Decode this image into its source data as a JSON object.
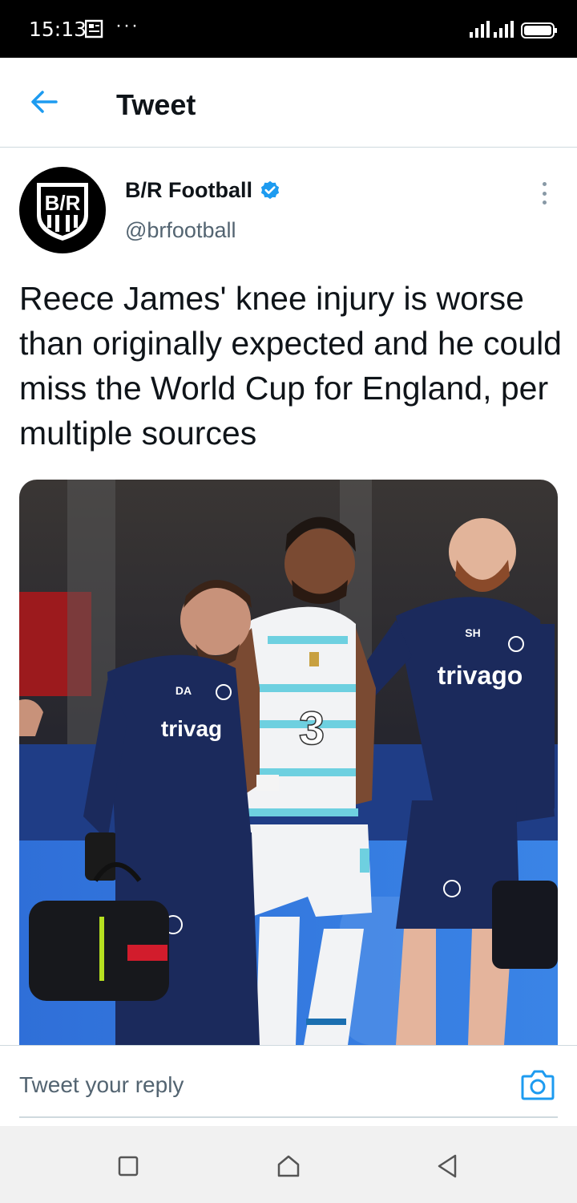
{
  "status_bar": {
    "time": "15:13",
    "notification_icon": "news-icon",
    "overflow_dots": "···"
  },
  "header": {
    "title": "Tweet",
    "back_icon": "arrow-left-icon"
  },
  "tweet": {
    "author_name": "B/R Football",
    "author_handle": "@brfootball",
    "avatar_text": "B/R",
    "verified": true,
    "text": "Reece James' knee injury is worse than originally expected and he could miss the World Cup for England, per multiple sources",
    "media": {
      "kit_sponsor": "trivago",
      "sponsor_partial": "trivag",
      "shirt_number": "3",
      "staff_initials_left": "DA",
      "staff_initials_right": "SH"
    }
  },
  "reply": {
    "placeholder": "Tweet your reply",
    "camera_icon": "camera-icon"
  },
  "nav_bar": {
    "recent_icon": "square-icon",
    "home_icon": "home-icon",
    "back_icon": "triangle-back-icon"
  },
  "colors": {
    "accent": "#1d9bf0",
    "text_primary": "#0f1419",
    "text_secondary": "#536471",
    "divider": "#cfd9de"
  }
}
